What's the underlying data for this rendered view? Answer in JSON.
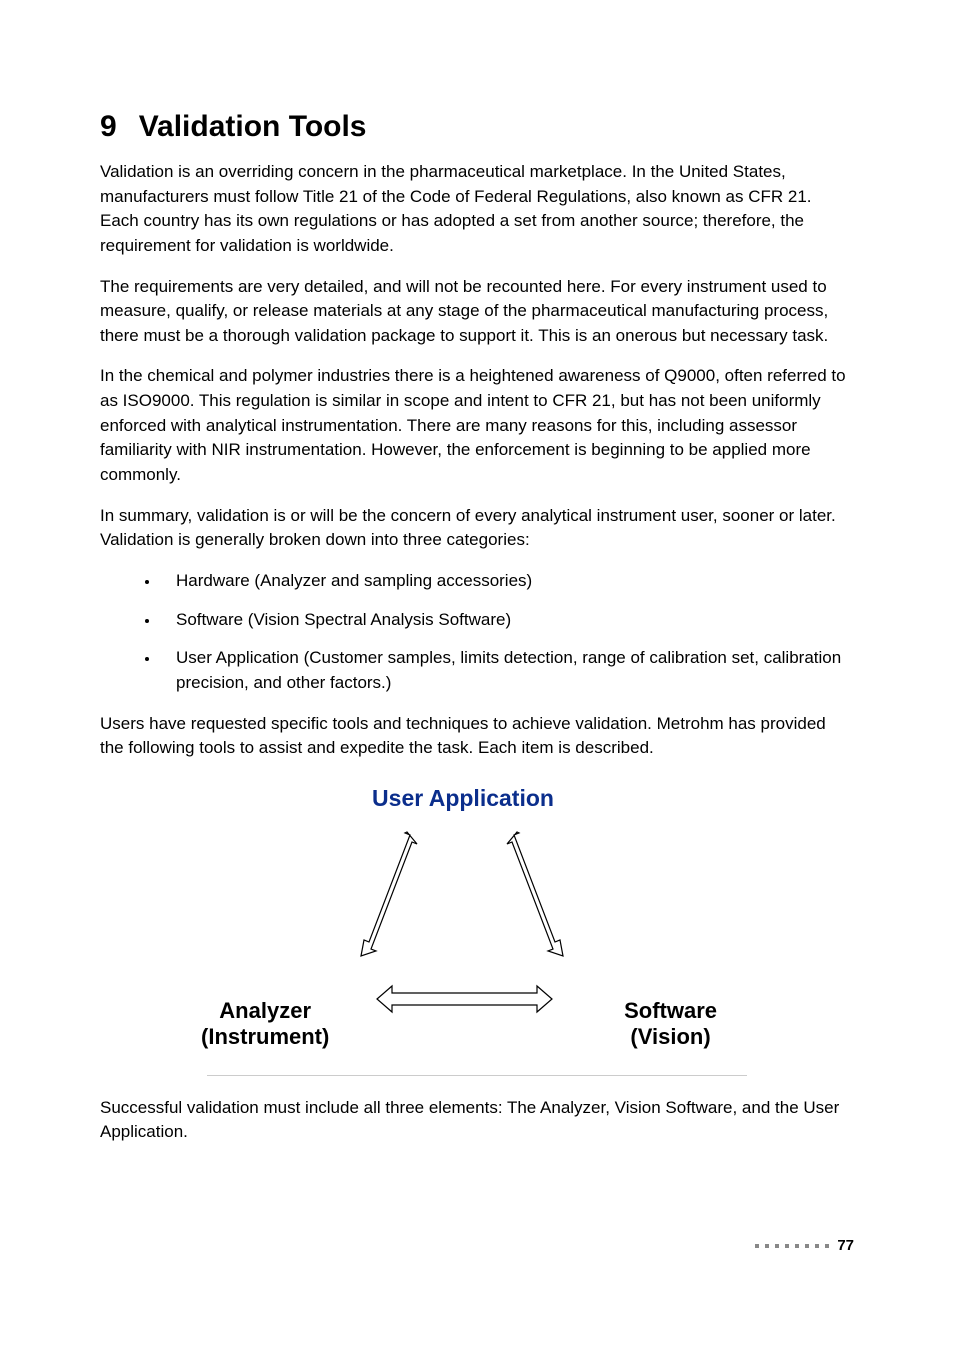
{
  "heading": {
    "number": "9",
    "title": "Validation Tools"
  },
  "paragraphs": {
    "p1": "Validation is an overriding concern in the pharmaceutical marketplace. In the United States, manufacturers must follow Title 21 of the Code of Federal Regulations, also known as CFR 21. Each country has its own regulations or has adopted a set from another source; therefore, the requirement for validation is worldwide.",
    "p2": "The requirements are very detailed, and will not be recounted here. For every instrument used to measure, qualify, or release materials at any stage of the pharmaceutical manufacturing process, there must be a thorough validation package to support it. This is an onerous but necessary task.",
    "p3": "In the chemical and polymer industries there is a heightened awareness of Q9000, often referred to as ISO9000. This regulation is similar in scope and intent to CFR 21, but has not been uniformly enforced with analytical instrumentation. There are many reasons for this, including assessor familiarity with NIR instrumentation. However, the enforcement is beginning to be applied more commonly.",
    "p4": "In summary, validation is or will be the concern of every analytical instrument user, sooner or later. Validation is generally broken down into three categories:",
    "p5": "Users have requested specific tools and techniques to achieve validation. Metrohm has provided the following tools to assist and expedite the task. Each item is described.",
    "p6": "Successful validation must include all three elements: The Analyzer, Vision Software, and the User Application."
  },
  "bullets": [
    "Hardware (Analyzer and sampling accessories)",
    "Software (Vision Spectral Analysis Software)",
    "User Application (Customer samples, limits detection, range of calibration set, calibration precision, and other factors.)"
  ],
  "diagram": {
    "top_label": "User Application",
    "bottom_left_line1": "Analyzer",
    "bottom_left_line2": "(Instrument)",
    "bottom_right_line1": "Software",
    "bottom_right_line2": "(Vision)"
  },
  "footer": {
    "page_number": "77"
  }
}
